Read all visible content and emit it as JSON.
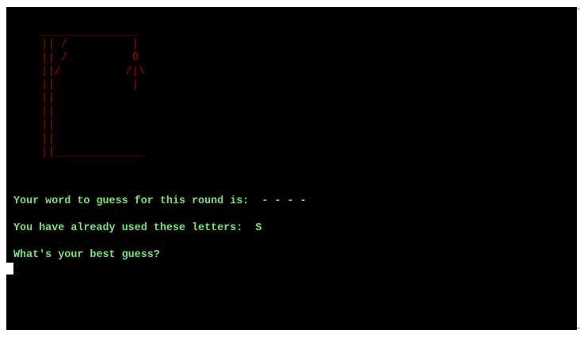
{
  "colors": {
    "terminal_background": "#000000",
    "prompt_text": "#7fe07f",
    "hangman_art": "#b00000",
    "cursor": "#ffffff"
  },
  "hangman": {
    "art": " _______________\n || /          |\n || /          O\n ||/          /|\\\n ||            |\n ||\n ||\n ||\n ||\n ||______________"
  },
  "game": {
    "word_line": "Your word to guess for this round is:  - - - -",
    "used_letters_line": "You have already used these letters:  S",
    "guess_prompt": "What's your best guess?"
  },
  "input": {
    "cursor": "block-cursor"
  }
}
